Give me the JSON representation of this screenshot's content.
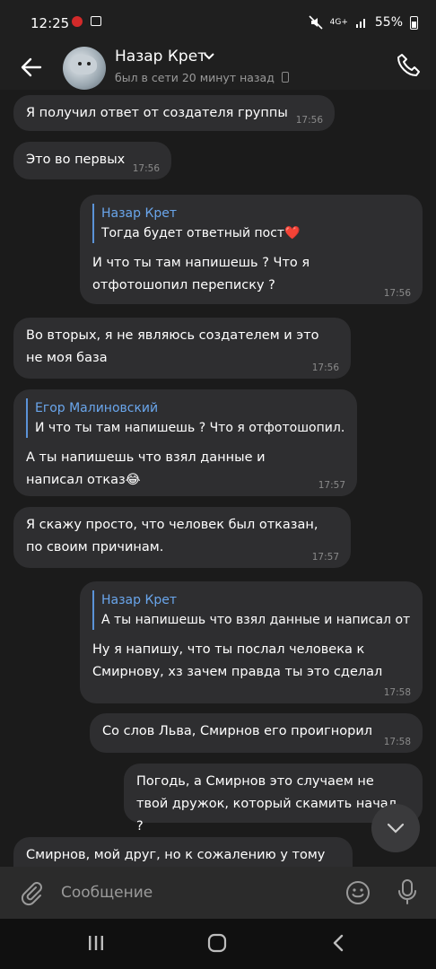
{
  "status_bar": {
    "time": "12:25",
    "network": "4G+",
    "battery": "55%",
    "icons": [
      "notification-icon",
      "gallery-icon",
      "mute-icon",
      "signal-icon",
      "battery-icon"
    ]
  },
  "header": {
    "contact_name": "Назар Крет",
    "last_seen": "был в сети 20 минут назад",
    "icons": [
      "back-arrow-icon",
      "avatar",
      "chevron-down-icon",
      "phone-icon",
      "call-icon"
    ]
  },
  "messages": [
    {
      "text": "Я получил ответ от создателя группы",
      "time": "17:56"
    },
    {
      "text": "Это во первых",
      "time": "17:56"
    },
    {
      "reply_name": "Назар Крет",
      "reply_text": "Тогда будет ответный пост❤️",
      "text": "И что ты там напишешь ? Что я отфотошопил переписку ?",
      "time": "17:56"
    },
    {
      "text": "Во вторых, я не являюсь создателем и это не моя база",
      "time": "17:56"
    },
    {
      "reply_name": "Егор Малиновский",
      "reply_text": "И что ты там напишешь ? Что я отфотошопил…",
      "text": "А ты напишешь что взял данные и написал отказ😂",
      "time": "17:57"
    },
    {
      "text": "Я скажу просто, что человек был отказан, по своим причинам.",
      "time": "17:57"
    },
    {
      "reply_name": "Назар Крет",
      "reply_text": "А ты напишешь что взял данные и написал от…",
      "text": "Ну я напишу, что ты послал человека к Смирнову, хз зачем правда ты это сделал",
      "time": "17:58"
    },
    {
      "text": "Со слов Льва, Смирнов его проигнорил",
      "time": "17:58"
    },
    {
      "text": "Погодь, а Смирнов это случаем не твой дружок, который скамить начал ?",
      "time": ""
    },
    {
      "text": "Смирнов, мой друг, но к сожалению у тому",
      "time": ""
    }
  ],
  "composer": {
    "placeholder": "Сообщение",
    "icons": [
      "attach-icon",
      "emoji-icon",
      "mic-icon"
    ]
  },
  "scroll_button": {
    "icon": "chevron-down-icon"
  },
  "nav_bar": {
    "icons": [
      "recent-apps-icon",
      "home-icon",
      "back-icon"
    ]
  },
  "colors": {
    "background": "#1b1b1b",
    "bubble": "#2e2e30",
    "reply_accent": "#6aa6ec",
    "time": "#8a8a8a"
  }
}
